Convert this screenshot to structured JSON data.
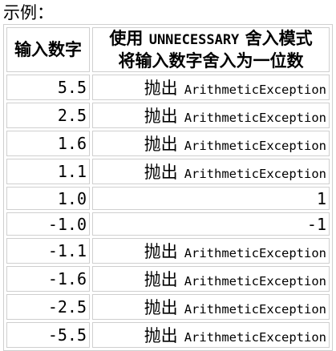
{
  "caption": "示例：",
  "header": {
    "col1": "输入数字",
    "col2_prefix": "使用",
    "col2_mode": "UNNECESSARY",
    "col2_suffix": "舍入模式",
    "col2_line2": "将输入数字舍入为一位数"
  },
  "rows": [
    {
      "input": "5.5",
      "throw": "抛出",
      "exception": "ArithmeticException",
      "value": ""
    },
    {
      "input": "2.5",
      "throw": "抛出",
      "exception": "ArithmeticException",
      "value": ""
    },
    {
      "input": "1.6",
      "throw": "抛出",
      "exception": "ArithmeticException",
      "value": ""
    },
    {
      "input": "1.1",
      "throw": "抛出",
      "exception": "ArithmeticException",
      "value": ""
    },
    {
      "input": "1.0",
      "throw": "",
      "exception": "",
      "value": "1"
    },
    {
      "input": "-1.0",
      "throw": "",
      "exception": "",
      "value": "-1"
    },
    {
      "input": "-1.1",
      "throw": "抛出",
      "exception": "ArithmeticException",
      "value": ""
    },
    {
      "input": "-1.6",
      "throw": "抛出",
      "exception": "ArithmeticException",
      "value": ""
    },
    {
      "input": "-2.5",
      "throw": "抛出",
      "exception": "ArithmeticException",
      "value": ""
    },
    {
      "input": "-5.5",
      "throw": "抛出",
      "exception": "ArithmeticException",
      "value": ""
    }
  ]
}
